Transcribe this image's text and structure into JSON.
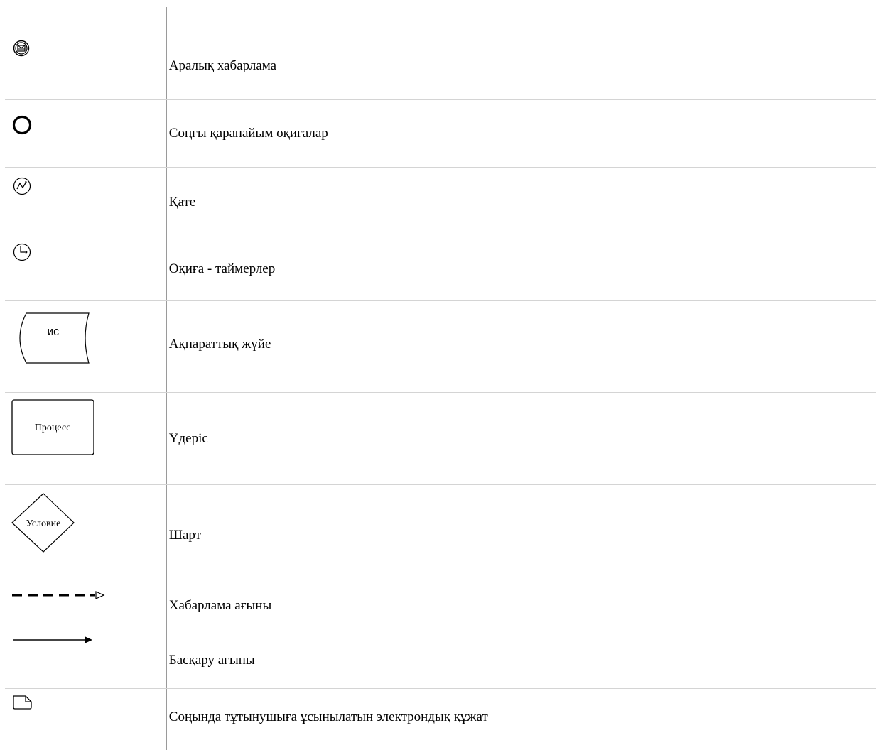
{
  "legend": {
    "rows": [
      {
        "icon": "intermediate-message-icon",
        "label": "Аралық хабарлама"
      },
      {
        "icon": "end-event-icon",
        "label": "Соңғы қарапайым оқиғалар"
      },
      {
        "icon": "error-icon",
        "label": "Қате"
      },
      {
        "icon": "timer-event-icon",
        "label": "Оқиға - таймерлер"
      },
      {
        "icon": "information-system-icon",
        "label": "Ақпараттық жүйе",
        "icon_text": "ИС"
      },
      {
        "icon": "process-icon",
        "label": "Үдеріс",
        "icon_text": "Процесс"
      },
      {
        "icon": "condition-icon",
        "label": "Шарт",
        "icon_text": "Условие"
      },
      {
        "icon": "message-flow-icon",
        "label": "Хабарлама ағыны"
      },
      {
        "icon": "control-flow-icon",
        "label": "Басқару ағыны"
      },
      {
        "icon": "electronic-document-icon",
        "label": "Соңында тұтынушыға ұсынылатын электрондық құжат"
      }
    ]
  }
}
